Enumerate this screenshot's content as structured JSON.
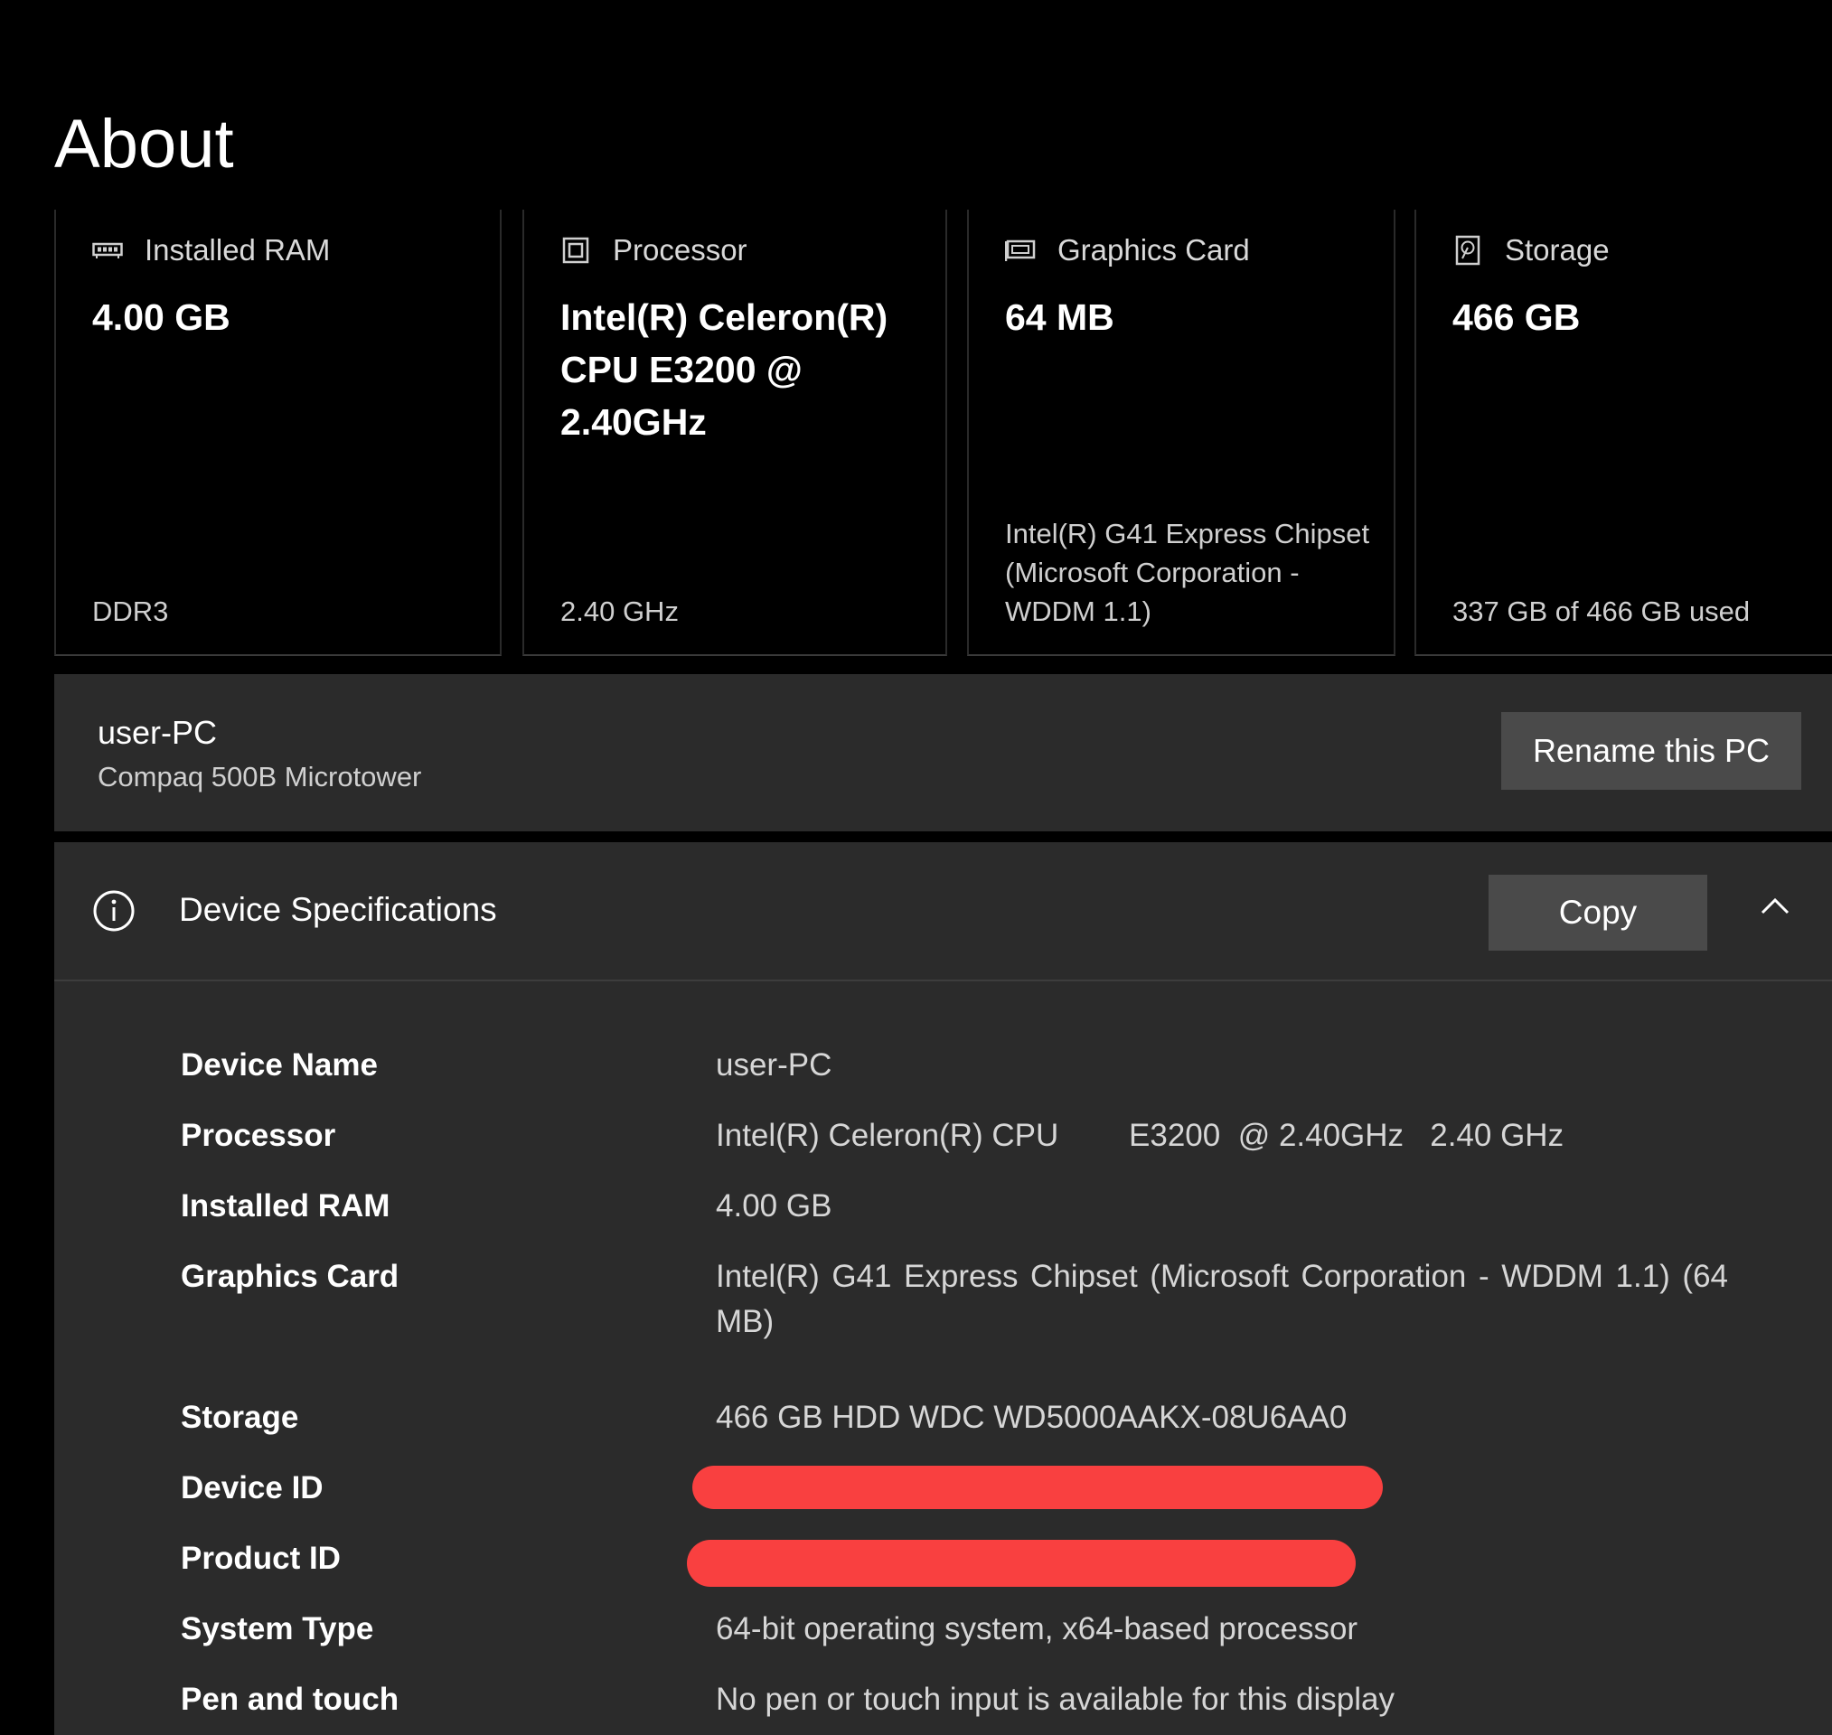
{
  "page": {
    "title": "About"
  },
  "cards": [
    {
      "label": "Installed RAM",
      "icon": "memory-icon",
      "value": "4.00 GB",
      "sub": "DDR3"
    },
    {
      "label": "Processor",
      "icon": "processor-icon",
      "value": "Intel(R) Celeron(R) CPU E3200 @ 2.40GHz",
      "sub": "2.40 GHz"
    },
    {
      "label": "Graphics Card",
      "icon": "graphics-card-icon",
      "value": "64 MB",
      "sub": "Intel(R) G41 Express Chipset (Microsoft Corporation - WDDM 1.1)"
    },
    {
      "label": "Storage",
      "icon": "storage-icon",
      "value": "466 GB",
      "sub": "337 GB of 466 GB used"
    }
  ],
  "pc": {
    "name": "user-PC",
    "model": "Compaq 500B Microtower",
    "rename_label": "Rename this PC"
  },
  "specs": {
    "title": "Device Specifications",
    "copy_label": "Copy",
    "rows": [
      {
        "key": "Device Name",
        "value": "user-PC"
      },
      {
        "key": "Processor",
        "value": "Intel(R) Celeron(R) CPU        E3200  @ 2.40GHz   2.40 GHz"
      },
      {
        "key": "Installed RAM",
        "value": "4.00 GB"
      },
      {
        "key": "Graphics Card",
        "value": "Intel(R) G41 Express Chipset (Microsoft Corporation - WDDM 1.1) (64 MB)"
      },
      {
        "key": "Storage",
        "value": "466 GB HDD WDC WD5000AAKX-08U6AA0"
      },
      {
        "key": "Device ID",
        "value": ""
      },
      {
        "key": "Product ID",
        "value": ""
      },
      {
        "key": "System Type",
        "value": "64-bit operating system, x64-based processor"
      },
      {
        "key": "Pen and touch",
        "value": "No pen or touch input is available for this display"
      }
    ]
  },
  "colors": {
    "background": "#000000",
    "panel": "#2b2b2b",
    "button": "#4a4a4a",
    "redaction": "#f94040"
  }
}
